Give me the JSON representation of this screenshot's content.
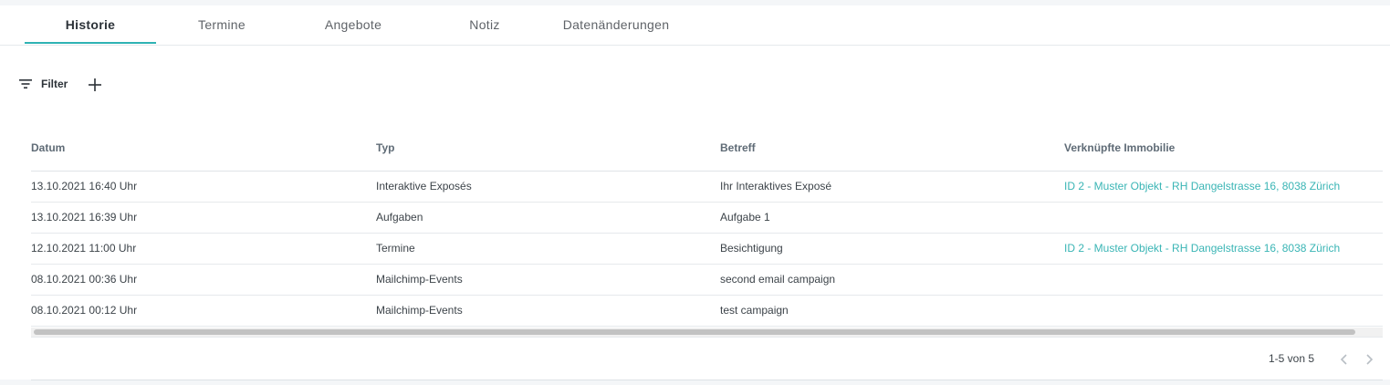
{
  "tabs": [
    {
      "label": "Historie",
      "active": true
    },
    {
      "label": "Termine",
      "active": false
    },
    {
      "label": "Angebote",
      "active": false
    },
    {
      "label": "Notiz",
      "active": false
    },
    {
      "label": "Datenänderungen",
      "active": false
    }
  ],
  "toolbar": {
    "filter_label": "Filter",
    "filter_icon": "filter-list-icon",
    "add_icon": "plus-icon"
  },
  "table": {
    "headers": [
      "Datum",
      "Typ",
      "Betreff",
      "Verknüpfte Immobilie"
    ],
    "rows": [
      [
        "13.10.2021 16:40 Uhr",
        "Interaktive Exposés",
        "Ihr Interaktives Exposé",
        "ID 2 - Muster Objekt - RH Dangelstrasse 16, 8038 Zürich"
      ],
      [
        "13.10.2021 16:39 Uhr",
        "Aufgaben",
        "Aufgabe 1",
        ""
      ],
      [
        "12.10.2021 11:00 Uhr",
        "Termine",
        "Besichtigung",
        "ID 2 - Muster Objekt - RH Dangelstrasse 16, 8038 Zürich"
      ],
      [
        "08.10.2021 00:36 Uhr",
        "Mailchimp-Events",
        "second email campaign",
        ""
      ],
      [
        "08.10.2021 00:12 Uhr",
        "Mailchimp-Events",
        "test campaign",
        ""
      ]
    ]
  },
  "pagination": {
    "info": "1-5 von 5",
    "prev_icon": "chevron-left-icon",
    "next_icon": "chevron-right-icon"
  },
  "colors": {
    "accent": "#2fb3b4",
    "link": "#3ab5b5"
  }
}
